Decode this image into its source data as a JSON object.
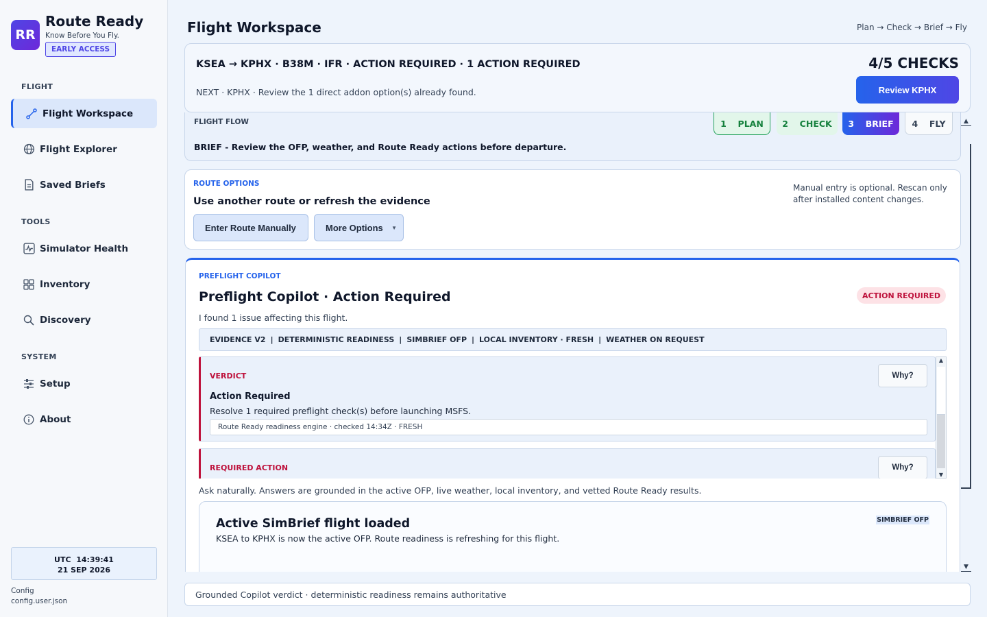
{
  "app": {
    "logo_text": "RR",
    "title": "Route Ready",
    "tagline": "Know Before You Fly.",
    "badge": "EARLY ACCESS"
  },
  "sidebar": {
    "sections": [
      {
        "label": "FLIGHT",
        "items": [
          {
            "label": "Flight Workspace",
            "icon": "route-icon",
            "active": true
          },
          {
            "label": "Flight Explorer",
            "icon": "globe-icon"
          },
          {
            "label": "Saved Briefs",
            "icon": "document-icon"
          }
        ]
      },
      {
        "label": "TOOLS",
        "items": [
          {
            "label": "Simulator Health",
            "icon": "pulse-icon"
          },
          {
            "label": "Inventory",
            "icon": "grid-icon"
          },
          {
            "label": "Discovery",
            "icon": "search-icon"
          }
        ]
      },
      {
        "label": "SYSTEM",
        "items": [
          {
            "label": "Setup",
            "icon": "sliders-icon"
          },
          {
            "label": "About",
            "icon": "info-icon"
          }
        ]
      }
    ],
    "clock": {
      "time": "UTC  14:39:41",
      "date": "21 SEP 2026"
    },
    "config": {
      "label": "Config",
      "file": "config.user.json"
    }
  },
  "header": {
    "title": "Flight Workspace",
    "flow": "Plan → Check → Brief → Fly"
  },
  "summary": {
    "title": "KSEA → KPHX · B38M · IFR · ACTION REQUIRED · 1 ACTION REQUIRED",
    "next": "NEXT · KPHX · Review the 1 direct addon option(s) already found.",
    "checks": "4/5 CHECKS",
    "button": "Review KPHX"
  },
  "flight_flow": {
    "label": "FLIGHT FLOW",
    "steps": [
      "1  PLAN",
      "2  CHECK",
      "3  BRIEF",
      "4  FLY"
    ],
    "active_step": 3,
    "description": "BRIEF - Review the OFP, weather, and Route Ready actions before departure."
  },
  "route_options": {
    "label": "ROUTE OPTIONS",
    "title": "Use another route or refresh the evidence",
    "buttons": [
      "Enter Route Manually",
      "More Options"
    ],
    "note": "Manual entry is optional. Rescan only after installed content changes."
  },
  "copilot": {
    "label": "PREFLIGHT COPILOT",
    "title": "Preflight Copilot · Action Required",
    "badge": "ACTION REQUIRED",
    "subtitle": "I found 1 issue affecting this flight.",
    "evidence": [
      "EVIDENCE V2",
      "DETERMINISTIC READINESS",
      "SIMBRIEF OFP",
      "LOCAL INVENTORY · FRESH",
      "WEATHER ON REQUEST"
    ],
    "cards": [
      {
        "label": "VERDICT",
        "why": "Why?",
        "title": "Action Required",
        "text": "Resolve 1 required preflight check(s) before launching MSFS.",
        "meta": "Route Ready readiness engine · checked 14:34Z · FRESH"
      },
      {
        "label": "REQUIRED ACTION",
        "why": "Why?"
      }
    ],
    "ask_hint": "Ask naturally. Answers are grounded in the active OFP, live weather, local inventory, and vetted Route Ready results.",
    "message": {
      "title": "Active SimBrief flight loaded",
      "text": "KSEA to KPHX is now the active OFP. Route readiness is refreshing for this flight.",
      "badge": "SIMBRIEF OFP"
    }
  },
  "footer": {
    "text": "Grounded Copilot verdict · deterministic readiness remains authoritative"
  }
}
